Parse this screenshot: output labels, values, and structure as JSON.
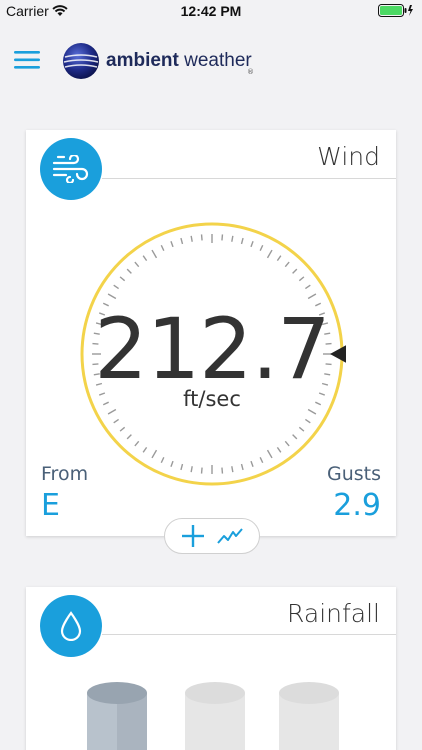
{
  "status_bar": {
    "carrier": "Carrier",
    "time": "12:42 PM"
  },
  "header": {
    "logo_bold": "ambient",
    "logo_light": "weather",
    "logo_mark": "®"
  },
  "wind_card": {
    "title": "Wind",
    "icon": "wind-icon",
    "speed": "212.7",
    "unit": "ft/sec",
    "from_label": "From",
    "from_value": "E",
    "gusts_label": "Gusts",
    "gusts_value": "2.9",
    "direction_degrees": 90
  },
  "rain_card": {
    "title": "Rainfall",
    "icon": "raindrop-icon"
  },
  "colors": {
    "accent": "#1a9fdc",
    "gauge_ring": "#f3d34a",
    "label": "#4a6078"
  }
}
